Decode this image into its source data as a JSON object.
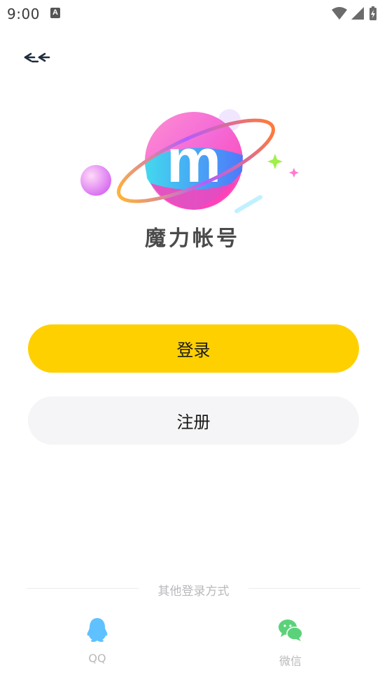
{
  "status_bar": {
    "time": "9:00",
    "notification_icon_letter": "A",
    "icons": [
      "wifi-icon",
      "signal-icon",
      "battery-charging-icon"
    ]
  },
  "header": {
    "back_icon": "back-arrow-icon"
  },
  "logo": {
    "letter": "m",
    "brand_name": "魔力帐号"
  },
  "actions": {
    "login_label": "登录",
    "register_label": "注册"
  },
  "other_login": {
    "label": "其他登录方式",
    "providers": [
      {
        "name": "QQ",
        "icon": "qq-icon"
      },
      {
        "name": "微信",
        "icon": "wechat-icon"
      }
    ]
  },
  "colors": {
    "primary_button": "#ffd000",
    "secondary_button": "#f5f5f7",
    "muted_text": "#b9b9bd",
    "qq_blue": "#5fc1ff",
    "wechat_green": "#5bd27a"
  }
}
